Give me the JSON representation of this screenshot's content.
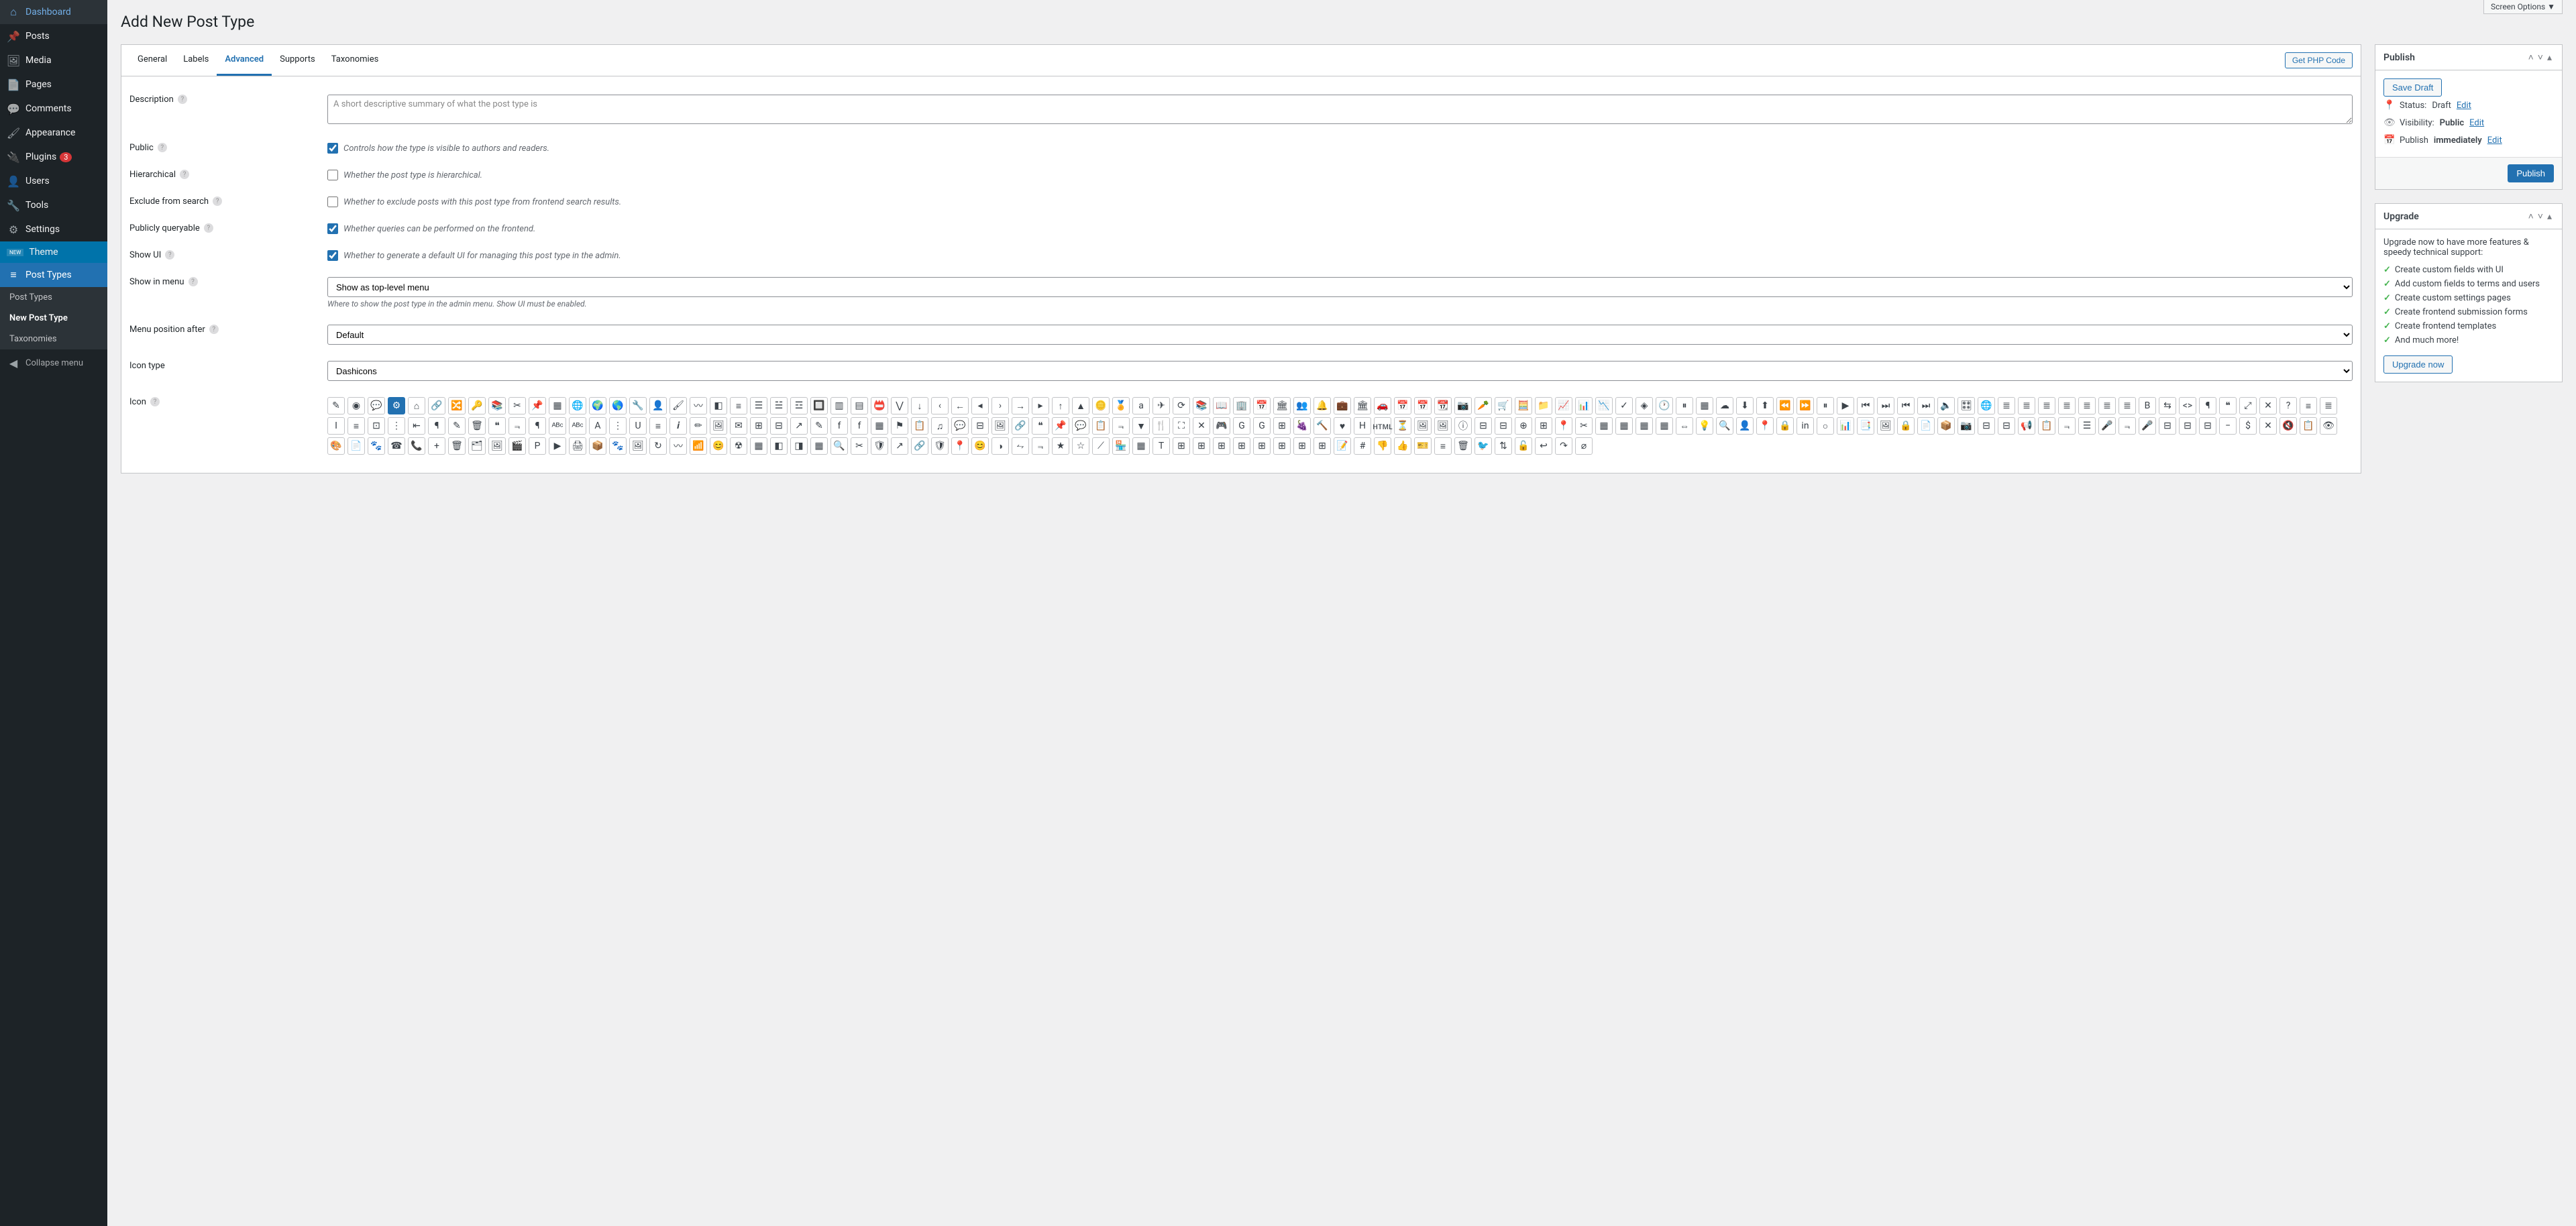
{
  "screen_options": "Screen Options ▼",
  "page_title": "Add New Post Type",
  "sidebar": {
    "items": [
      {
        "name": "dashboard",
        "label": "Dashboard",
        "icon": "⌂"
      },
      {
        "name": "posts",
        "label": "Posts",
        "icon": "📌"
      },
      {
        "name": "media",
        "label": "Media",
        "icon": "🖼"
      },
      {
        "name": "pages",
        "label": "Pages",
        "icon": "📄"
      },
      {
        "name": "comments",
        "label": "Comments",
        "icon": "💬"
      },
      {
        "name": "appearance",
        "label": "Appearance",
        "icon": "🖌"
      },
      {
        "name": "plugins",
        "label": "Plugins",
        "icon": "🔌",
        "badge": "3"
      },
      {
        "name": "users",
        "label": "Users",
        "icon": "👤"
      },
      {
        "name": "tools",
        "label": "Tools",
        "icon": "🔧"
      },
      {
        "name": "settings",
        "label": "Settings",
        "icon": "⚙"
      },
      {
        "name": "theme",
        "label": "Theme"
      },
      {
        "name": "post-types",
        "label": "Post Types",
        "icon": "≡",
        "active": true
      }
    ],
    "submenu": [
      {
        "label": "Post Types"
      },
      {
        "label": "New Post Type",
        "current": true
      },
      {
        "label": "Taxonomies"
      }
    ],
    "collapse": "Collapse menu"
  },
  "tabs": {
    "items": [
      {
        "label": "General"
      },
      {
        "label": "Labels"
      },
      {
        "label": "Advanced",
        "active": true
      },
      {
        "label": "Supports"
      },
      {
        "label": "Taxonomies"
      }
    ],
    "action": "Get PHP Code"
  },
  "fields": {
    "description": {
      "label": "Description",
      "placeholder": "A short descriptive summary of what the post type is"
    },
    "public": {
      "label": "Public",
      "desc": "Controls how the type is visible to authors and readers.",
      "checked": true
    },
    "hierarchical": {
      "label": "Hierarchical",
      "desc": "Whether the post type is hierarchical.",
      "checked": false
    },
    "exclude_search": {
      "label": "Exclude from search",
      "desc": "Whether to exclude posts with this post type from frontend search results.",
      "checked": false
    },
    "publicly_queryable": {
      "label": "Publicly queryable",
      "desc": "Whether queries can be performed on the frontend.",
      "checked": true
    },
    "show_ui": {
      "label": "Show UI",
      "desc": "Whether to generate a default UI for managing this post type in the admin.",
      "checked": true
    },
    "show_in_menu": {
      "label": "Show in menu",
      "value": "Show as top-level menu",
      "desc": "Where to show the post type in the admin menu. Show UI must be enabled."
    },
    "menu_position": {
      "label": "Menu position after",
      "value": "Default"
    },
    "icon_type": {
      "label": "Icon type",
      "value": "Dashicons"
    },
    "icon": {
      "label": "Icon"
    }
  },
  "dashicons": [
    "✎",
    "◉",
    "💬",
    "⚙",
    "⌂",
    "🔗",
    "🔀",
    "🔑",
    "📚",
    "✂",
    "📌",
    "▦",
    "🌐",
    "🌍",
    "🌎",
    "🔧",
    "👤",
    "🖌",
    "〰",
    "◧",
    "≡",
    "☰",
    "☱",
    "☲",
    "🔲",
    "▥",
    "▤",
    "📛",
    "⋁",
    "↓",
    "‹",
    "←",
    "◂",
    "›",
    "→",
    "▸",
    "↑",
    "▲",
    "🪙",
    "🏅",
    "a",
    "✈",
    "⟳",
    "📚",
    "📖",
    "🏢",
    "📅",
    "🏛",
    "👥",
    "🔔",
    "💼",
    "🏛",
    "🚗",
    "📅",
    "📅",
    "📆",
    "📷",
    "🥕",
    "🛒",
    "🧮",
    "📁",
    "📈",
    "📊",
    "📉",
    "✓",
    "◈",
    "🕐",
    "⏸",
    "▦",
    "☁",
    "⬇",
    "⬆",
    "⏪",
    "⏩",
    "⏸",
    "▶",
    "⏮",
    "⏭",
    "⏮",
    "⏭",
    "🔈",
    "🎛",
    "🌐",
    "≣",
    "≣",
    "≣",
    "≣",
    "≣",
    "≣",
    "≣",
    "B",
    "⇆",
    "<>",
    "¶",
    "❝",
    "⤢",
    "✕",
    "?",
    "≡",
    "≣",
    "I",
    "≡",
    "⊡",
    "⋮",
    "⇤",
    "¶",
    "✎",
    "🗑",
    "❝",
    "⫬",
    "¶",
    "ᴬᴮᶜ",
    "ᴬᴮᶜ",
    "A",
    "⋮",
    "U",
    "≡",
    "𝒊",
    "✏",
    "🖼",
    "✉",
    "⊞",
    "⊟",
    "↗",
    "✎",
    "f",
    "f",
    "▦",
    "⚑",
    "📋",
    "♫",
    "💬",
    "⊟",
    "🖼",
    "🔗",
    "❝",
    "📌",
    "💬",
    "📋",
    "⫬",
    "▼",
    "🍴",
    "⛶",
    "✕",
    "🎮",
    "G",
    "G",
    "⊞",
    "🍇",
    "🔨",
    "♥",
    "H",
    "ʜᴛᴍʟ",
    "⏳",
    "🖼",
    "🖼",
    "ⓘ",
    "⊟",
    "⊟",
    "⊕",
    "⊞",
    "📍",
    "✂",
    "▦",
    "▦",
    "▦",
    "▦",
    "⇔",
    "💡",
    "🔍",
    "👤",
    "📍",
    "🔒",
    "in",
    "○",
    "📊",
    "📑",
    "🖼",
    "🔒",
    "📄",
    "📦",
    "📷",
    "⊟",
    "⊟",
    "📢",
    "📋",
    "⫬",
    "☰",
    "🎤",
    "⫬",
    "🎤",
    "⊟",
    "⊟",
    "⊟",
    "−",
    "$",
    "✕",
    "🔇",
    "📋",
    "👁",
    "🎨",
    "📄",
    "🐾",
    "☎",
    "📞",
    "+",
    "🗑",
    "🗂",
    "🖼",
    "🎬",
    "P",
    "▶",
    "🖨",
    "📦",
    "🐾",
    "🖼",
    "↻",
    "〰",
    "📶",
    "😊",
    "☢",
    "▦",
    "◧",
    "◨",
    "▦",
    "🔍",
    "✂",
    "🛡",
    "↗",
    "🔗",
    "🛡",
    "📍",
    "😊",
    "◑",
    "⥊",
    "⫬",
    "★",
    "☆",
    "⟋",
    "🏪",
    "▦",
    "T",
    "⊞",
    "⊞",
    "⊞",
    "⊞",
    "⊞",
    "⊞",
    "⊞",
    "⊞",
    "📝",
    "#",
    "👎",
    "👍",
    "🎫",
    "≡",
    "🗑",
    "🐦",
    "⇅",
    "🔓",
    "↩",
    "↷",
    "⌀"
  ],
  "icon_selected": 3,
  "publish": {
    "title": "Publish",
    "save_draft": "Save Draft",
    "status_label": "Status:",
    "status_value": "Draft",
    "status_edit": "Edit",
    "visibility_label": "Visibility:",
    "visibility_value": "Public",
    "visibility_edit": "Edit",
    "publish_label": "Publish",
    "publish_value": "immediately",
    "publish_edit": "Edit",
    "button": "Publish"
  },
  "upgrade": {
    "title": "Upgrade",
    "intro": "Upgrade now to have more features & speedy technical support:",
    "features": [
      "Create custom fields with UI",
      "Add custom fields to terms and users",
      "Create custom settings pages",
      "Create frontend submission forms",
      "Create frontend templates",
      "And much more!"
    ],
    "button": "Upgrade now"
  }
}
